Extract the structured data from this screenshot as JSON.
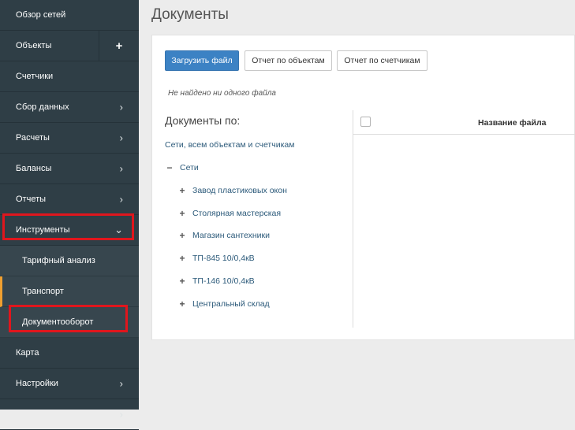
{
  "sidebar": {
    "items": [
      {
        "label": "Обзор сетей"
      },
      {
        "label": "Объекты",
        "action": "+"
      },
      {
        "label": "Счетчики"
      },
      {
        "label": "Сбор данных",
        "chevron": "›"
      },
      {
        "label": "Расчеты",
        "chevron": "›"
      },
      {
        "label": "Балансы",
        "chevron": "›"
      },
      {
        "label": "Отчеты",
        "chevron": "›"
      },
      {
        "label": "Инструменты",
        "chevron": "⌄"
      }
    ],
    "submenu": [
      {
        "label": "Тарифный анализ"
      },
      {
        "label": "Транспорт"
      },
      {
        "label": "Документооборот"
      }
    ],
    "bottom_items": [
      {
        "label": "Карта"
      },
      {
        "label": "Настройки",
        "chevron": "›"
      },
      {
        "label": "",
        "chevron": "›"
      }
    ],
    "accent_color": "#f0a030",
    "highlight_color": "#e0161d"
  },
  "main": {
    "title": "Документы",
    "buttons": {
      "upload": "Загрузить файл",
      "report_objects": "Отчет по объектам",
      "report_meters": "Отчет по счетчикам"
    },
    "not_found": "Не найдено ни одного файла",
    "tree": {
      "heading": "Документы по:",
      "all_link": "Сети, всем объектам и счетчикам",
      "root": {
        "icon": "minus-icon",
        "label": "Сети"
      },
      "children": [
        {
          "icon": "plus-icon",
          "label": "Завод пластиковых окон"
        },
        {
          "icon": "plus-icon",
          "label": "Столярная мастерская"
        },
        {
          "icon": "plus-icon",
          "label": "Магазин сантехники"
        },
        {
          "icon": "plus-icon",
          "label": "ТП-845 10/0,4кВ"
        },
        {
          "icon": "plus-icon",
          "label": "ТП-146 10/0,4кВ"
        },
        {
          "icon": "plus-icon",
          "label": "Центральный склад"
        }
      ]
    },
    "table": {
      "columns": [
        "Название файла"
      ]
    }
  }
}
